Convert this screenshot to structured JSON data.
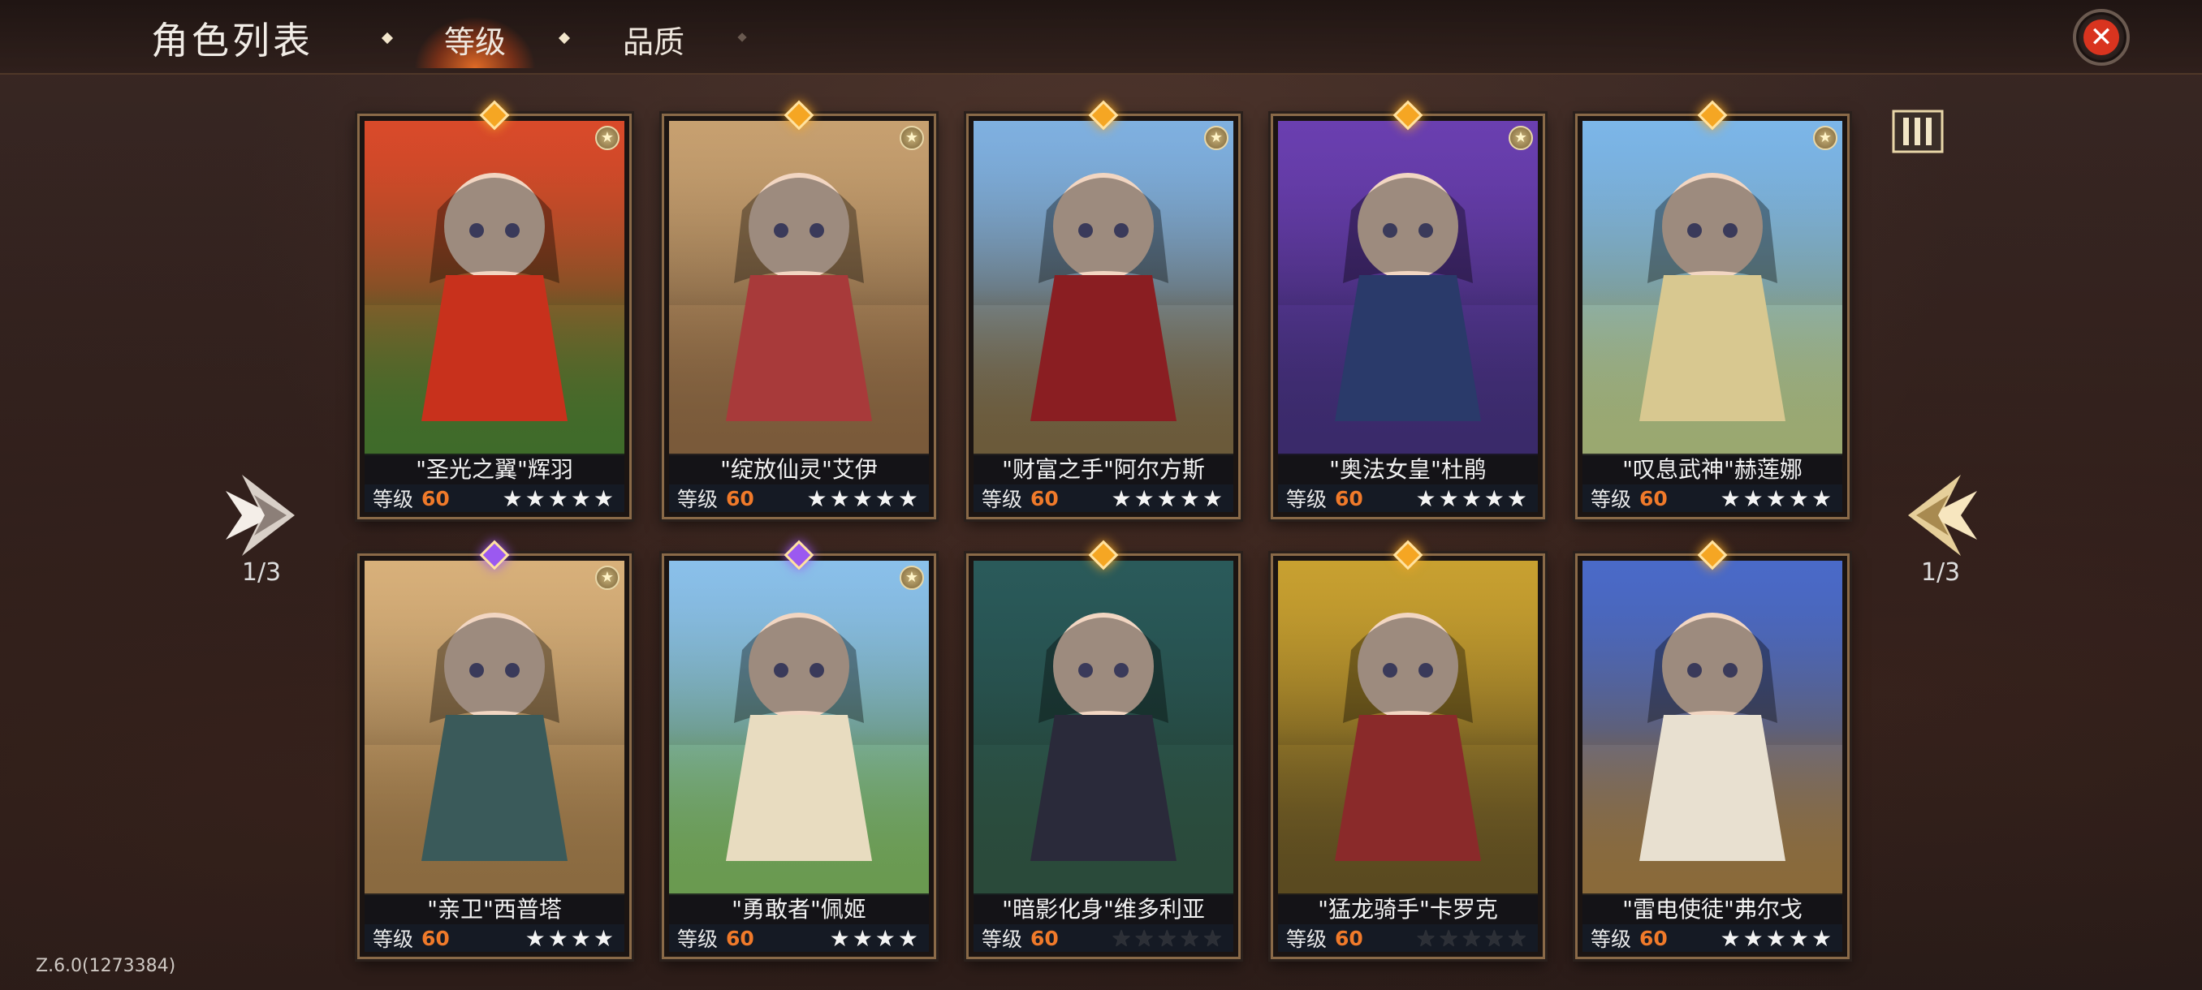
{
  "header": {
    "title": "角色列表",
    "tabs": [
      {
        "label": "等级",
        "active": true
      },
      {
        "label": "品质",
        "active": false
      }
    ],
    "close_icon": "close-icon"
  },
  "pagination": {
    "left": "1/3",
    "right": "1/3"
  },
  "level_label": "等级",
  "cards": [
    {
      "name": "\"圣光之翼\"辉羽",
      "level": "60",
      "stars": "★★★★★",
      "star_style": "lit",
      "gem_color": "#f5a623",
      "sky": "#d94a2a",
      "ground": "#3f6b2a",
      "figure_color": "#c8311c",
      "badge": true
    },
    {
      "name": "\"绽放仙灵\"艾伊",
      "level": "60",
      "stars": "★★★★★",
      "star_style": "lit",
      "gem_color": "#f5a623",
      "sky": "#c7a070",
      "ground": "#7a5a3a",
      "figure_color": "#a83a3a",
      "badge": true
    },
    {
      "name": "\"财富之手\"阿尔方斯",
      "level": "60",
      "stars": "★★★★★",
      "star_style": "lit",
      "gem_color": "#f5a623",
      "sky": "#7fb0e0",
      "ground": "#6b5a3a",
      "figure_color": "#8a1e22",
      "badge": true
    },
    {
      "name": "\"奥法女皇\"杜鹃",
      "level": "60",
      "stars": "★★★★★",
      "star_style": "lit",
      "gem_color": "#f5a623",
      "sky": "#6a3fb0",
      "ground": "#3a2a6a",
      "figure_color": "#2a3a6a",
      "badge": true
    },
    {
      "name": "\"叹息武神\"赫莲娜",
      "level": "60",
      "stars": "★★★★★",
      "star_style": "lit",
      "gem_color": "#f5a623",
      "sky": "#7cb6e8",
      "ground": "#9aa870",
      "figure_color": "#d8c890",
      "badge": true
    },
    {
      "name": "\"亲卫\"西普塔",
      "level": "60",
      "stars": "★★★★",
      "star_style": "lit",
      "gem_color": "#9b59f0",
      "sky": "#d8b07a",
      "ground": "#8a6a40",
      "figure_color": "#3a5a5a",
      "badge": true
    },
    {
      "name": "\"勇敢者\"佩姬",
      "level": "60",
      "stars": "★★★★",
      "star_style": "lit",
      "gem_color": "#9b59f0",
      "sky": "#8ac0ea",
      "ground": "#6a9a50",
      "figure_color": "#e8dcc0",
      "badge": true
    },
    {
      "name": "\"暗影化身\"维多利亚",
      "level": "60",
      "stars": "★★★★★",
      "star_style": "dim",
      "gem_color": "#f5a623",
      "sky": "#2a5a5a",
      "ground": "#2a4a3a",
      "figure_color": "#2a2a3a",
      "badge": false
    },
    {
      "name": "\"猛龙骑手\"卡罗克",
      "level": "60",
      "stars": "★★★★★",
      "star_style": "dim",
      "gem_color": "#f5a623",
      "sky": "#c8a030",
      "ground": "#5a4a20",
      "figure_color": "#8a2a2a",
      "badge": false
    },
    {
      "name": "\"雷电使徒\"弗尔戈",
      "level": "60",
      "stars": "★★★★★",
      "star_style": "lit",
      "gem_color": "#f5a623",
      "sky": "#4a6ac8",
      "ground": "#8a6a3a",
      "figure_color": "#e8e0d0",
      "badge": false
    }
  ],
  "version": "Z.6.0(1273384)"
}
